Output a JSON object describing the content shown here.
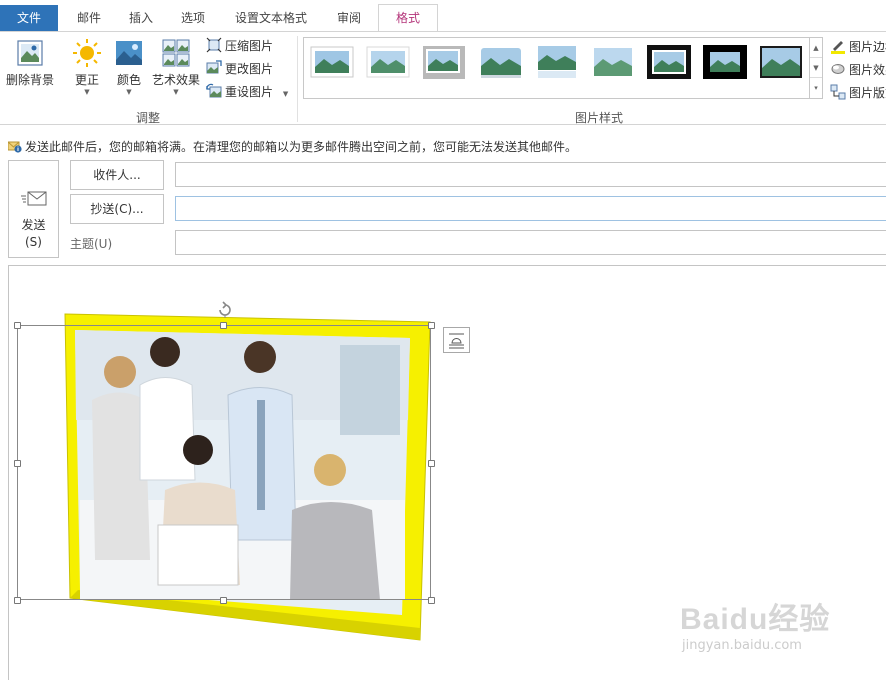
{
  "tabs": [
    {
      "label": "文件",
      "kind": "file"
    },
    {
      "label": "邮件"
    },
    {
      "label": "插入"
    },
    {
      "label": "选项"
    },
    {
      "label": "设置文本格式"
    },
    {
      "label": "审阅"
    },
    {
      "label": "格式",
      "active": true
    }
  ],
  "ribbon": {
    "remove_bg": "删除背景",
    "corrections": "更正",
    "color": "颜色",
    "art_effects": "艺术效果",
    "compress": "压缩图片",
    "change": "更改图片",
    "reset": "重设图片",
    "adjust_group": "调整",
    "styles_group": "图片样式",
    "border": "图片边框",
    "effects": "图片效果",
    "layout": "图片版式"
  },
  "notice": {
    "text": "发送此邮件后，您的邮箱将满。在清理您的邮箱以为更多邮件腾出空间之前，您可能无法发送其他邮件。"
  },
  "compose": {
    "send_label_1": "发送",
    "send_label_2": "(S)",
    "to_button": "收件人...",
    "cc_button": "抄送(C)...",
    "subject_label": "主题(U)",
    "to_value": "",
    "cc_value": "",
    "subject_value": ""
  },
  "colors": {
    "file_tab": "#2e73b8",
    "active_tab_text": "#b4357a",
    "picture_border": "#f6f000"
  },
  "watermark": {
    "brand": "Baidu经验",
    "url": "jingyan.baidu.com"
  }
}
